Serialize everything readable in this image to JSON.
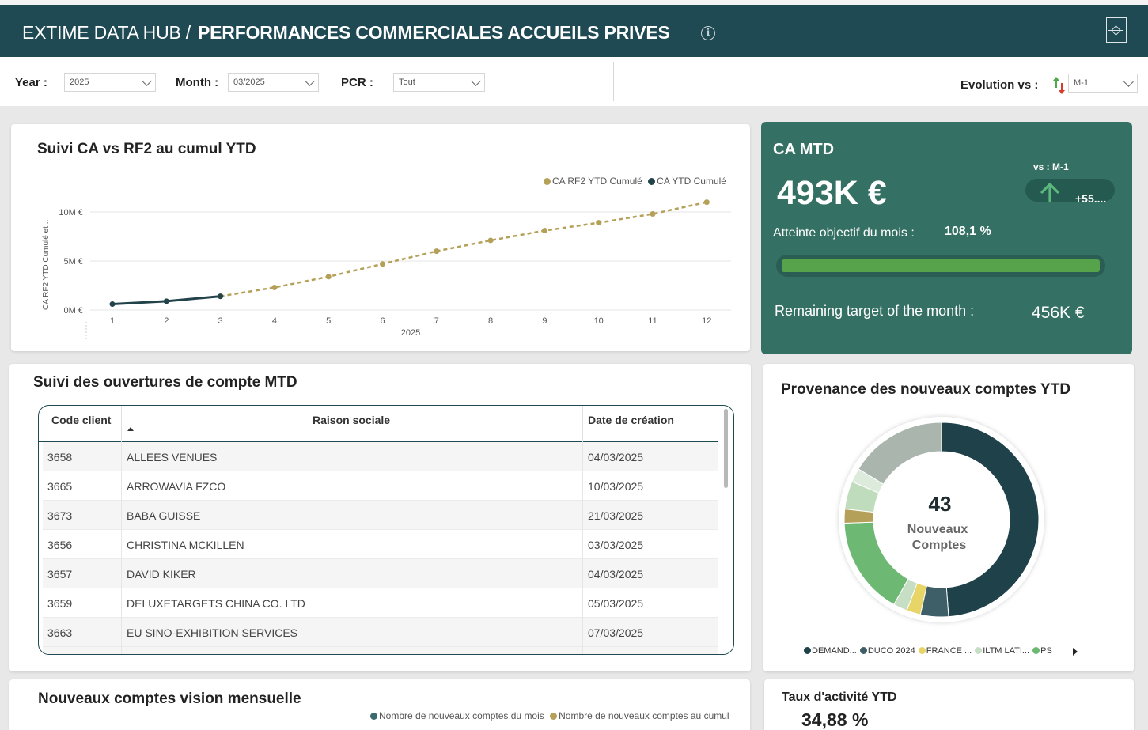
{
  "header": {
    "hub": "EXTIME DATA HUB /",
    "title": "PERFORMANCES COMMERCIALES ACCUEILS PRIVES"
  },
  "filters": {
    "year_label": "Year :",
    "year_value": "2025",
    "month_label": "Month :",
    "month_value": "03/2025",
    "pcr_label": "PCR :",
    "pcr_value": "Tout",
    "evolution_label": "Evolution vs :",
    "evolution_value": "M-1"
  },
  "ca_chart": {
    "title": "Suivi CA vs RF2 au cumul YTD",
    "chart_data": {
      "type": "line",
      "x": [
        1,
        2,
        3,
        4,
        5,
        6,
        7,
        8,
        9,
        10,
        11,
        12
      ],
      "xlabel": "2025",
      "ylabel": "CA RF2 YTD Cumulé et...",
      "yticks": [
        "0M €",
        "5M €",
        "10M €"
      ],
      "ylim": [
        0,
        10
      ],
      "y_unit": "M €",
      "series": [
        {
          "name": "CA RF2 YTD Cumulé",
          "color": "#b5a058",
          "style": "dashed",
          "x": [
            3,
            4,
            5,
            6,
            7,
            8,
            9,
            10,
            11,
            12
          ],
          "values": [
            1.4,
            2.3,
            3.4,
            4.7,
            6.0,
            7.1,
            8.1,
            8.9,
            9.8,
            11.0
          ]
        },
        {
          "name": "CA YTD Cumulé",
          "color": "#23434b",
          "style": "solid",
          "x": [
            1,
            2,
            3
          ],
          "values": [
            0.6,
            0.9,
            1.4
          ]
        }
      ],
      "grid": true,
      "legend": "top-right"
    }
  },
  "kpi": {
    "title": "CA MTD",
    "value": "493K €",
    "vs_label": "vs :",
    "vs_value": "M-1",
    "delta": "+55....",
    "objective_label": "Atteinte objectif du mois :",
    "objective_value": "108,1 %",
    "objective_fraction": 1.0,
    "remaining_label": "Remaining target of the month :",
    "remaining_value": "456K €",
    "colors": {
      "bg": "#347063",
      "bar": "#56a34c",
      "arrow": "#5cb87c"
    }
  },
  "accounts_table": {
    "title": "Suivi des ouvertures de compte MTD",
    "columns": [
      "Code client",
      "Raison sociale",
      "Date de création"
    ],
    "rows": [
      [
        "3658",
        "ALLEES VENUES",
        "04/03/2025"
      ],
      [
        "3665",
        "ARROWAVIA FZCO",
        "10/03/2025"
      ],
      [
        "3673",
        "BABA GUISSE",
        "21/03/2025"
      ],
      [
        "3656",
        "CHRISTINA MCKILLEN",
        "03/03/2025"
      ],
      [
        "3657",
        "DAVID KIKER",
        "04/03/2025"
      ],
      [
        "3659",
        "DELUXETARGETS CHINA CO. LTD",
        "05/03/2025"
      ],
      [
        "3663",
        "EU SINO-EXHIBITION SERVICES",
        "07/03/2025"
      ]
    ]
  },
  "provenance": {
    "title": "Provenance des nouveaux comptes YTD",
    "center_value": "43",
    "center_label_1": "Nouveaux",
    "center_label_2": "Comptes",
    "chart_data": {
      "type": "pie",
      "labels": [
        "DEMAND...",
        "DUCO 2024",
        "FRANCE ...",
        "ILTM LATI...",
        "PS",
        "",
        "",
        "",
        ""
      ],
      "values": [
        21,
        2,
        1,
        1,
        7,
        1,
        2,
        1,
        7
      ],
      "colors": [
        "#1f414a",
        "#3e5f67",
        "#e8d567",
        "#c6dfc4",
        "#6db873",
        "#b5a05a",
        "#bfdcbc",
        "#dcebdc",
        "#a9b5ad"
      ]
    },
    "legend": [
      {
        "label": "DEMAND...",
        "color": "#1f414a"
      },
      {
        "label": "DUCO 2024",
        "color": "#3e5f67"
      },
      {
        "label": "FRANCE ...",
        "color": "#e8d567"
      },
      {
        "label": "ILTM LATI...",
        "color": "#c6dfc4"
      },
      {
        "label": "PS",
        "color": "#6db873"
      }
    ]
  },
  "monthly": {
    "title": "Nouveaux comptes vision mensuelle",
    "legend_1": "Nombre de nouveaux comptes du mois",
    "legend_2": "Nombre de nouveaux comptes au cumul",
    "colors": [
      "#3d6970",
      "#b5a058"
    ]
  },
  "activity": {
    "title": "Taux d'activité YTD",
    "value": "34,88 %"
  }
}
